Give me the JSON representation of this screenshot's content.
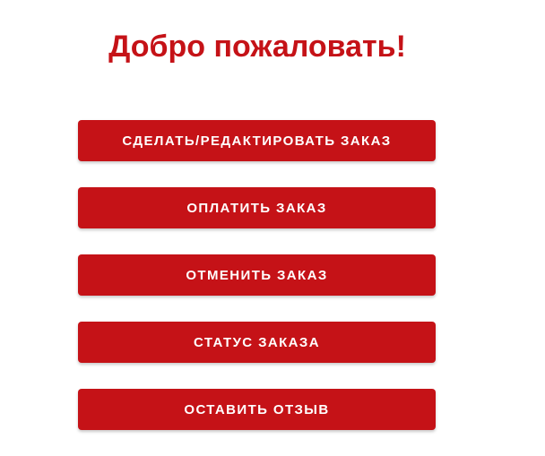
{
  "page": {
    "title": "Добро пожаловать!"
  },
  "menu": {
    "buttons": [
      {
        "label": "СДЕЛАТЬ/РЕДАКТИРОВАТЬ ЗАКАЗ"
      },
      {
        "label": "ОПЛАТИТЬ ЗАКАЗ"
      },
      {
        "label": "ОТМЕНИТЬ ЗАКАЗ"
      },
      {
        "label": "СТАТУС ЗАКАЗА"
      },
      {
        "label": "ОСТАВИТЬ ОТЗЫВ"
      }
    ]
  },
  "colors": {
    "accent": "#c51217",
    "button_text": "#ffffff",
    "background": "#ffffff"
  }
}
